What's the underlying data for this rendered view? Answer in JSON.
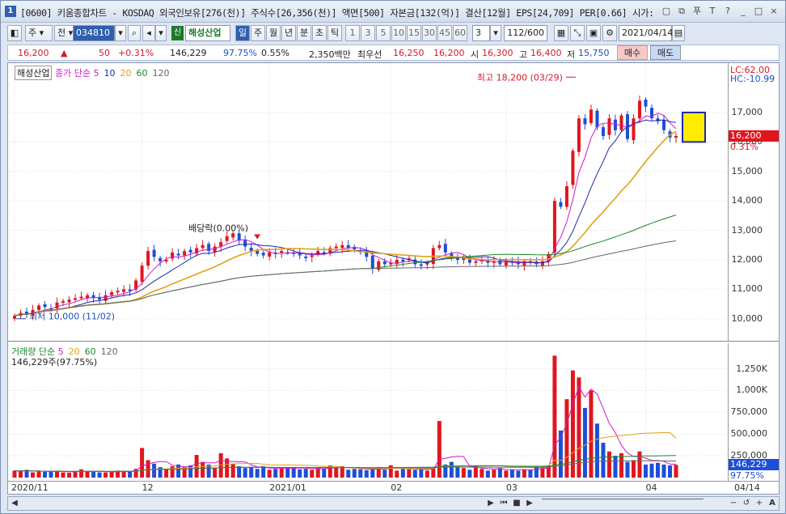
{
  "window": {
    "number": "1",
    "title": "[0600] 키움종합차트 - KOSDAQ 외국인보유[276(천)] 주식수[26,356(천)] 액면[500] 자본금[132(억)] 결산[12월] EPS[24,709] PER[0.66] 시가:",
    "icons": [
      "window-icon",
      "copy-icon",
      "pin-icon",
      "text-icon",
      "help-icon",
      "minimize-icon",
      "restore-icon",
      "close-icon"
    ],
    "icon_glyphs": [
      "▢",
      "⧉",
      "푸",
      "T",
      "?",
      "_",
      "□",
      "×"
    ]
  },
  "toolbar": {
    "period_type": "주",
    "prev_label": "전",
    "code": "034810",
    "market_badge": "신",
    "stock_name": "해성산업",
    "periods": [
      "일",
      "주",
      "월",
      "년",
      "분",
      "초",
      "틱"
    ],
    "selected_period": "일",
    "minutes": [
      "1",
      "3",
      "5",
      "10",
      "15",
      "30",
      "45",
      "60"
    ],
    "interval_value": "3",
    "count": "112/600",
    "date": "2021/04/14"
  },
  "quote": {
    "price": "16,200",
    "arrow": "▲",
    "change": "50",
    "change_pct": "+0.31%",
    "volume": "146,229",
    "vol_ratio": "97.75%",
    "turnover": "0.55%",
    "amount": "2,350백만",
    "best_bid_label": "최우선",
    "best_ask": "16,250",
    "best_bid": "16,200",
    "open_label": "시",
    "open": "16,300",
    "high_label": "고",
    "high": "16,400",
    "low_label": "저",
    "low": "15,750",
    "buy_label": "매수",
    "sell_label": "매도"
  },
  "price_panel": {
    "stock_tag": "해성산업",
    "legend_title": "종가 단순",
    "ma_periods": [
      "5",
      "10",
      "20",
      "60",
      "120"
    ],
    "ma_colors": [
      "#d218c8",
      "#1d2aa8",
      "#e0a21a",
      "#1a8a2a",
      "#666666"
    ],
    "lc": "LC:62.00",
    "hc": "HC:-10.99",
    "current_price_tag": "16,200",
    "current_pct_tag": "0.31%",
    "high_annot": "최고 18,200 (03/29)",
    "low_annot": "최저 10,000 (11/02)",
    "dividend_annot": "배당락(0.00%)",
    "y_ticks": [
      "17,000",
      "16,000",
      "15,000",
      "14,000",
      "13,000",
      "12,000",
      "11,000",
      "10,000"
    ]
  },
  "volume_panel": {
    "legend_title": "거래량 단순",
    "ma_periods": [
      "5",
      "20",
      "60",
      "120"
    ],
    "ma_colors": [
      "#d218c8",
      "#e0a21a",
      "#1a8a2a",
      "#666666"
    ],
    "volume_text": "146,229주(97.75%)",
    "last_volume_tag": "146,229",
    "last_pct_tag": "97.75%",
    "y_ticks": [
      "1,250K",
      "1,000K",
      "750,000",
      "500,000",
      "250,000"
    ]
  },
  "x_axis": {
    "labels": [
      "2020/11",
      "12",
      "2021/01",
      "02",
      "03",
      "04"
    ],
    "end_label": "04/14"
  },
  "chart_data": {
    "type": "candlestick",
    "x_start": "2020/11/02",
    "x_end": "2021/04/14",
    "ylim": [
      9500,
      18400
    ],
    "volume_ylim": [
      0,
      1450000
    ],
    "closes": [
      10100,
      10200,
      10150,
      10300,
      10450,
      10400,
      10350,
      10550,
      10600,
      10650,
      10700,
      10750,
      10800,
      10700,
      10650,
      10800,
      10900,
      10950,
      11000,
      10950,
      11300,
      11800,
      12300,
      12100,
      11950,
      12000,
      12250,
      12150,
      12300,
      12250,
      12400,
      12500,
      12300,
      12450,
      12600,
      12800,
      12900,
      12650,
      12450,
      12300,
      12200,
      12150,
      12250,
      12200,
      12300,
      12250,
      12200,
      12150,
      12100,
      12150,
      12300,
      12250,
      12400,
      12450,
      12500,
      12400,
      12350,
      12300,
      12100,
      11700,
      11950,
      11850,
      11900,
      12000,
      11950,
      12050,
      11850,
      11800,
      11900,
      12400,
      12500,
      12250,
      12100,
      12000,
      12050,
      11900,
      11950,
      12000,
      11900,
      11950,
      11850,
      11950,
      11900,
      11850,
      11950,
      11900,
      11850,
      11950,
      12200,
      14000,
      13800,
      14500,
      15700,
      16800,
      16600,
      17100,
      16500,
      16200,
      16800,
      16400,
      16900,
      16100,
      16800,
      17400,
      17200,
      16800,
      16700,
      16400,
      16150,
      16200
    ],
    "volumes": [
      80000,
      70000,
      90000,
      60000,
      75000,
      65000,
      70000,
      80000,
      60000,
      55000,
      75000,
      95000,
      65000,
      70000,
      60000,
      60000,
      70000,
      80000,
      75000,
      70000,
      100000,
      340000,
      200000,
      160000,
      120000,
      100000,
      130000,
      150000,
      120000,
      140000,
      260000,
      180000,
      150000,
      110000,
      280000,
      220000,
      160000,
      130000,
      110000,
      120000,
      100000,
      130000,
      90000,
      100000,
      120000,
      110000,
      120000,
      95000,
      100000,
      90000,
      120000,
      100000,
      140000,
      110000,
      130000,
      90000,
      100000,
      95000,
      85000,
      100000,
      120000,
      90000,
      140000,
      80000,
      100000,
      95000,
      90000,
      100000,
      80000,
      120000,
      650000,
      150000,
      180000,
      120000,
      110000,
      90000,
      130000,
      100000,
      80000,
      90000,
      110000,
      80000,
      90000,
      80000,
      95000,
      90000,
      120000,
      110000,
      140000,
      1400000,
      540000,
      900000,
      1230000,
      1150000,
      800000,
      1000000,
      620000,
      400000,
      300000,
      250000,
      280000,
      180000,
      200000,
      300000,
      150000,
      160000,
      170000,
      150000,
      140000,
      146229
    ]
  }
}
